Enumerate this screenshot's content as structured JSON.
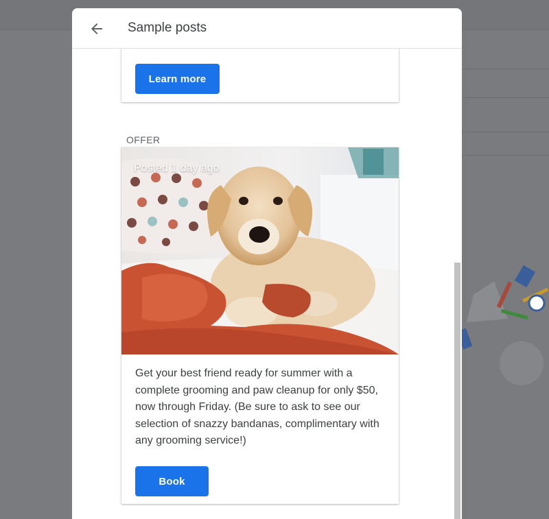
{
  "dialog": {
    "title": "Sample posts",
    "back_icon": "arrow-left-icon"
  },
  "previous_post": {
    "button_label": "Learn more"
  },
  "offer_post": {
    "section_label": "OFFER",
    "posted_label": "Posted 1 day ago",
    "image": "golden-retriever-puppy-photo",
    "description": "Get your best friend ready for summer with a complete grooming and paw cleanup for only $50, now through Friday. (Be sure to ask to see our selection of snazzy bandanas, complimentary with any grooming service!)",
    "button_label": "Book"
  },
  "colors": {
    "accent": "#1a73e8",
    "overlay": "#7a7b7e"
  }
}
